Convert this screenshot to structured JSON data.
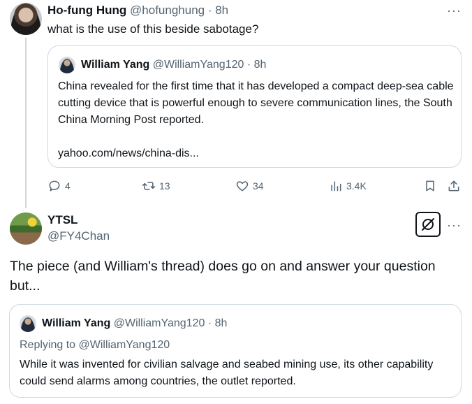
{
  "tweet1": {
    "author_name": "Ho-fung Hung",
    "author_handle": "@hofunghung",
    "time": "· 8h",
    "more": "···",
    "text": "what is the use of this beside sabotage?",
    "quote": {
      "author_name": "William Yang",
      "author_handle": "@WilliamYang120",
      "time": "· 8h",
      "text": "China revealed for the first time that it has developed a compact deep-sea cable cutting device that is powerful enough to severe communication lines, the South China Morning Post reported.",
      "link": "yahoo.com/news/china-dis..."
    },
    "actions": {
      "replies": "4",
      "reposts": "13",
      "likes": "34",
      "views": "3.4K"
    }
  },
  "tweet2": {
    "author_name": "YTSL",
    "author_handle": "@FY4Chan",
    "more": "···",
    "text": "The piece (and William's thread) does go on and answer your question but...",
    "quote": {
      "author_name": "William Yang",
      "author_handle": "@WilliamYang120",
      "time": "· 8h",
      "replying_to": "Replying to @WilliamYang120",
      "text": "While it was invented for civilian salvage and seabed mining use, its other capability could send alarms among countries, the outlet reported."
    }
  },
  "icons": {
    "reply": "reply-icon",
    "repost": "repost-icon",
    "like": "like-icon",
    "views": "views-icon",
    "bookmark": "bookmark-icon",
    "share": "share-icon",
    "grok": "grok-icon"
  }
}
